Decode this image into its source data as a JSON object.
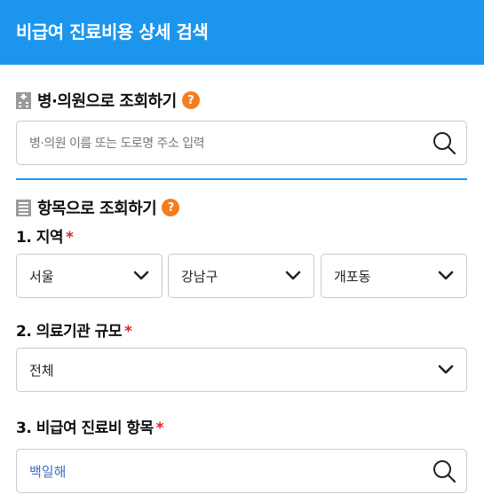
{
  "header": {
    "title": "비급여 진료비용 상세 검색"
  },
  "section_hospital": {
    "title": "병·의원으로 조회하기",
    "help": "?",
    "search_placeholder": "병·의원 이름 또는 도로명 주소 입력"
  },
  "section_item": {
    "title": "항목으로 조회하기",
    "help": "?"
  },
  "region": {
    "label": "1. 지역",
    "required": "*",
    "city": "서울",
    "district": "강남구",
    "dong": "개포동"
  },
  "scale": {
    "label": "2. 의료기관 규모",
    "required": "*",
    "value": "전체"
  },
  "treatment": {
    "label": "3. 비급여 진료비 항목",
    "required": "*",
    "value": "백일해"
  },
  "colors": {
    "header": "#1b96ec",
    "help": "#f47d20",
    "required": "#e02020"
  }
}
